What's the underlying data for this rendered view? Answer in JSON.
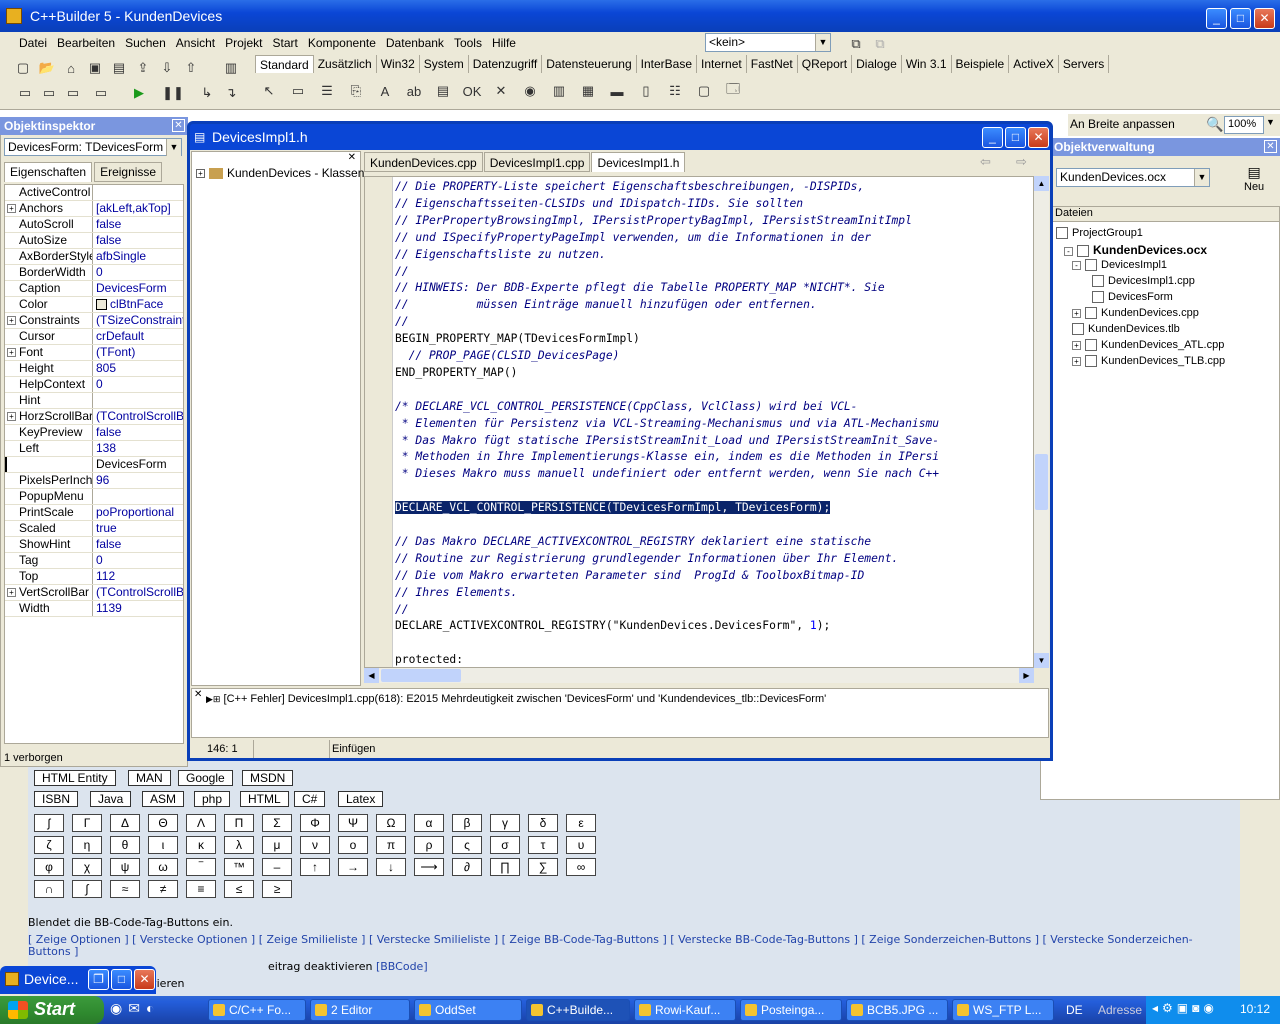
{
  "ide": {
    "title": "C++Builder 5 - KundenDevices",
    "menu": [
      "Datei",
      "Bearbeiten",
      "Suchen",
      "Ansicht",
      "Projekt",
      "Start",
      "Komponente",
      "Datenbank",
      "Tools",
      "Hilfe"
    ],
    "config_combo": "<kein>",
    "palette_tabs": [
      "Standard",
      "Zusätzlich",
      "Win32",
      "System",
      "Datenzugriff",
      "Datensteuerung",
      "InterBase",
      "Internet",
      "FastNet",
      "QReport",
      "Dialoge",
      "Win 3.1",
      "Beispiele",
      "ActiveX",
      "Servers"
    ],
    "palette_active": "Standard"
  },
  "zoom_toolbar": {
    "fit_width": "An Breite anpassen",
    "zoom": "100%"
  },
  "object_inspector": {
    "title": "Objektinspektor",
    "selected": "DevicesForm: TDevicesForm",
    "tabs": [
      "Eigenschaften",
      "Ereignisse"
    ],
    "properties": [
      {
        "name": "ActiveControl",
        "value": "",
        "expand": false
      },
      {
        "name": "Anchors",
        "value": "[akLeft,akTop]",
        "expand": true
      },
      {
        "name": "AutoScroll",
        "value": "false",
        "expand": false
      },
      {
        "name": "AutoSize",
        "value": "false",
        "expand": false
      },
      {
        "name": "AxBorderStyle",
        "value": "afbSingle",
        "expand": false
      },
      {
        "name": "BorderWidth",
        "value": "0",
        "expand": false
      },
      {
        "name": "Caption",
        "value": "DevicesForm",
        "expand": false
      },
      {
        "name": "Color",
        "value": "clBtnFace",
        "expand": false
      },
      {
        "name": "Constraints",
        "value": "(TSizeConstraints)",
        "expand": true
      },
      {
        "name": "Cursor",
        "value": "crDefault",
        "expand": false
      },
      {
        "name": "Font",
        "value": "(TFont)",
        "expand": true
      },
      {
        "name": "Height",
        "value": "805",
        "expand": false
      },
      {
        "name": "HelpContext",
        "value": "0",
        "expand": false
      },
      {
        "name": "Hint",
        "value": "",
        "expand": false
      },
      {
        "name": "HorzScrollBar",
        "value": "(TControlScrollBar)",
        "expand": true
      },
      {
        "name": "KeyPreview",
        "value": "false",
        "expand": false
      },
      {
        "name": "Left",
        "value": "138",
        "expand": false
      },
      {
        "name": "Name",
        "value": "DevicesForm",
        "expand": false
      },
      {
        "name": "PixelsPerInch",
        "value": "96",
        "expand": false
      },
      {
        "name": "PopupMenu",
        "value": "",
        "expand": false
      },
      {
        "name": "PrintScale",
        "value": "poProportional",
        "expand": false
      },
      {
        "name": "Scaled",
        "value": "true",
        "expand": false
      },
      {
        "name": "ShowHint",
        "value": "false",
        "expand": false
      },
      {
        "name": "Tag",
        "value": "0",
        "expand": false
      },
      {
        "name": "Top",
        "value": "112",
        "expand": false
      },
      {
        "name": "VertScrollBar",
        "value": "(TControlScrollBar)",
        "expand": true
      },
      {
        "name": "Width",
        "value": "1139",
        "expand": false
      }
    ],
    "status": "1 verborgen"
  },
  "editor": {
    "title": "DevicesImpl1.h",
    "class_root": "KundenDevices - Klassen",
    "tabs": [
      "KundenDevices.cpp",
      "DevicesImpl1.cpp",
      "DevicesImpl1.h"
    ],
    "active_tab": "DevicesImpl1.h",
    "code_lines": [
      {
        "t": "// Die PROPERTY-Liste speichert Eigenschaftsbeschreibungen, -DISPIDs,",
        "c": "cm"
      },
      {
        "t": "// Eigenschaftsseiten-CLSIDs und IDispatch-IIDs. Sie sollten",
        "c": "cm"
      },
      {
        "t": "// IPerPropertyBrowsingImpl, IPersistPropertyBagImpl, IPersistStreamInitImpl",
        "c": "cm"
      },
      {
        "t": "// und ISpecifyPropertyPageImpl verwenden, um die Informationen in der",
        "c": "cm"
      },
      {
        "t": "// Eigenschaftsliste zu nutzen.",
        "c": "cm"
      },
      {
        "t": "//",
        "c": "cm"
      },
      {
        "t": "// HINWEIS: Der BDB-Experte pflegt die Tabelle PROPERTY_MAP *NICHT*. Sie",
        "c": "cm"
      },
      {
        "t": "//          müssen Einträge manuell hinzufügen oder entfernen.",
        "c": "cm"
      },
      {
        "t": "//",
        "c": "cm"
      },
      {
        "t": "BEGIN_PROPERTY_MAP(TDevicesFormImpl)",
        "c": ""
      },
      {
        "t": "  // PROP_PAGE(CLSID_DevicesPage)",
        "c": "cm"
      },
      {
        "t": "END_PROPERTY_MAP()",
        "c": ""
      },
      {
        "t": "",
        "c": ""
      },
      {
        "t": "/* DECLARE_VCL_CONTROL_PERSISTENCE(CppClass, VclClass) wird bei VCL-",
        "c": "cm"
      },
      {
        "t": " * Elementen für Persistenz via VCL-Streaming-Mechanismus und via ATL-Mechanismu",
        "c": "cm"
      },
      {
        "t": " * Das Makro fügt statische IPersistStreamInit_Load und IPersistStreamInit_Save-",
        "c": "cm"
      },
      {
        "t": " * Methoden in Ihre Implementierungs-Klasse ein, indem es die Methoden in IPersi",
        "c": "cm"
      },
      {
        "t": " * Dieses Makro muss manuell undefiniert oder entfernt werden, wenn Sie nach C++",
        "c": "cm"
      },
      {
        "t": "",
        "c": ""
      },
      {
        "t": "DECLARE_VCL_CONTROL_PERSISTENCE(TDevicesFormImpl, TDevicesForm);",
        "c": "sel"
      },
      {
        "t": "",
        "c": ""
      },
      {
        "t": "// Das Makro DECLARE_ACTIVEXCONTROL_REGISTRY deklariert eine statische",
        "c": "cm"
      },
      {
        "t": "// Routine zur Registrierung grundlegender Informationen über Ihr Element.",
        "c": "cm"
      },
      {
        "t": "// Die vom Makro erwarteten Parameter sind  ProgId & ToolboxBitmap-ID",
        "c": "cm"
      },
      {
        "t": "// Ihres Elements.",
        "c": "cm"
      },
      {
        "t": "//",
        "c": "cm"
      },
      {
        "t": "DECLARE_ACTIVEXCONTROL_REGISTRY(\"KundenDevices.DevicesForm\", 1);",
        "c": "reg"
      },
      {
        "t": "",
        "c": ""
      },
      {
        "t": "protected:",
        "c": ""
      }
    ],
    "message": "[C++ Fehler] DevicesImpl1.cpp(618): E2015 Mehrdeutigkeit zwischen 'DevicesForm' und 'Kundendevices_tlb::DevicesForm'",
    "status_pos": "146:  1",
    "status_mode": "Einfügen"
  },
  "project_manager": {
    "title": "Objektverwaltung",
    "combo": "KundenDevices.ocx",
    "new_label": "Neu",
    "header": "Dateien",
    "tree": [
      {
        "label": "ProjectGroup1",
        "bold": false
      },
      {
        "label": "KundenDevices.ocx",
        "bold": true
      },
      {
        "label": "DevicesImpl1",
        "bold": false
      },
      {
        "label": "DevicesImpl1.cpp",
        "bold": false
      },
      {
        "label": "DevicesForm",
        "bold": false
      },
      {
        "label": "KundenDevices.cpp",
        "bold": false
      },
      {
        "label": "KundenDevices.tlb",
        "bold": false
      },
      {
        "label": "KundenDevices_ATL.cpp",
        "bold": false
      },
      {
        "label": "KundenDevices_TLB.cpp",
        "bold": false
      }
    ]
  },
  "web": {
    "row1": [
      "HTML Entity",
      "MAN",
      "Google",
      "MSDN"
    ],
    "row2": [
      "ISBN",
      "Java",
      "ASM",
      "php",
      "HTML",
      "C#",
      "Latex"
    ],
    "symbols": [
      [
        "ʃ",
        "Γ",
        "Δ",
        "Θ",
        "Λ",
        "Π",
        "Σ",
        "Φ",
        "Ψ",
        "Ω",
        "α",
        "β",
        "γ",
        "δ",
        "ε"
      ],
      [
        "ζ",
        "η",
        "θ",
        "ι",
        "κ",
        "λ",
        "μ",
        "ν",
        "ο",
        "π",
        "ρ",
        "ς",
        "σ",
        "τ",
        "υ"
      ],
      [
        "φ",
        "χ",
        "ψ",
        "ω",
        "‾",
        "™",
        "–",
        "↑",
        "→",
        "↓",
        "⟶",
        "∂",
        "∏",
        "∑",
        "∞"
      ],
      [
        "∩",
        "∫",
        "≈",
        "≠",
        "≡",
        "≤",
        "≥"
      ]
    ],
    "hint": "Blendet die BB-Code-Tag-Buttons ein.",
    "links": "[ Zeige Optionen ] [ Verstecke Optionen ] [ Zeige Smilieliste ] [ Verstecke Smilieliste ] [ Zeige BB-Code-Tag-Buttons ] [ Verstecke BB-Code-Tag-Buttons ] [ Zeige Sonderzeichen-Buttons ] [ Verstecke Sonderzeichen-Buttons ]",
    "line1": "eitrag deaktivieren",
    "line1_tag": "[BBCode]",
    "line2": "eitrag deaktivieren"
  },
  "minimized": {
    "title": "Device..."
  },
  "taskbar": {
    "start": "Start",
    "tasks": [
      "C/C++ Fo...",
      "2 Editor",
      "OddSet",
      "C++Builde...",
      "Rowi-Kauf...",
      "Posteinga...",
      "BCB5.JPG ...",
      "WS_FTP L..."
    ],
    "active_task": "C++Builde...",
    "lang": "DE",
    "address": "Adresse",
    "clock": "10:12"
  }
}
